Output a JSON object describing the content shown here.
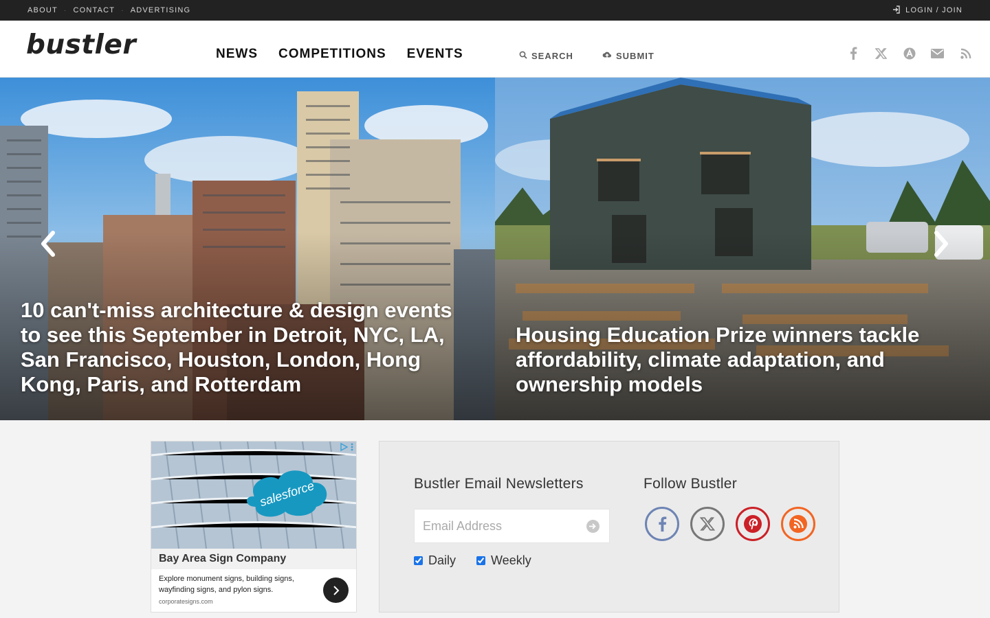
{
  "topbar": {
    "links": [
      "ABOUT",
      "CONTACT",
      "ADVERTISING"
    ],
    "separator": "·",
    "login": "LOGIN / JOIN"
  },
  "header": {
    "logo": "bustler",
    "nav": [
      "NEWS",
      "COMPETITIONS",
      "EVENTS"
    ],
    "search": "SEARCH",
    "submit": "SUBMIT",
    "social_icons": [
      "facebook-icon",
      "x-icon",
      "archinect-icon",
      "envelope-icon",
      "rss-icon"
    ]
  },
  "hero": {
    "slides": [
      {
        "title": "10 can't-miss architecture & design events to see this September in Detroit, NYC, LA, San Francisco, Houston, London, Hong Kong, Paris, and Rotterdam"
      },
      {
        "title": "Housing Education Prize winners tackle affordability, climate adaptation, and ownership models"
      }
    ]
  },
  "ad": {
    "brand_sign": "salesforce",
    "company": "Bay Area Sign Company",
    "description": "Explore monument signs, building signs, wayfinding signs, and pylon signs.",
    "domain": "corporatesigns.com"
  },
  "newsletter": {
    "title": "Bustler Email Newsletters",
    "email_placeholder": "Email Address",
    "options": [
      {
        "label": "Daily",
        "checked": true
      },
      {
        "label": "Weekly",
        "checked": true
      }
    ]
  },
  "follow": {
    "title": "Follow Bustler",
    "networks": [
      {
        "icon": "facebook-icon",
        "color": "#6d84b4"
      },
      {
        "icon": "x-icon",
        "color": "#777777"
      },
      {
        "icon": "pinterest-icon",
        "color": "#cb2027"
      },
      {
        "icon": "rss-icon",
        "color": "#f26522"
      }
    ]
  }
}
